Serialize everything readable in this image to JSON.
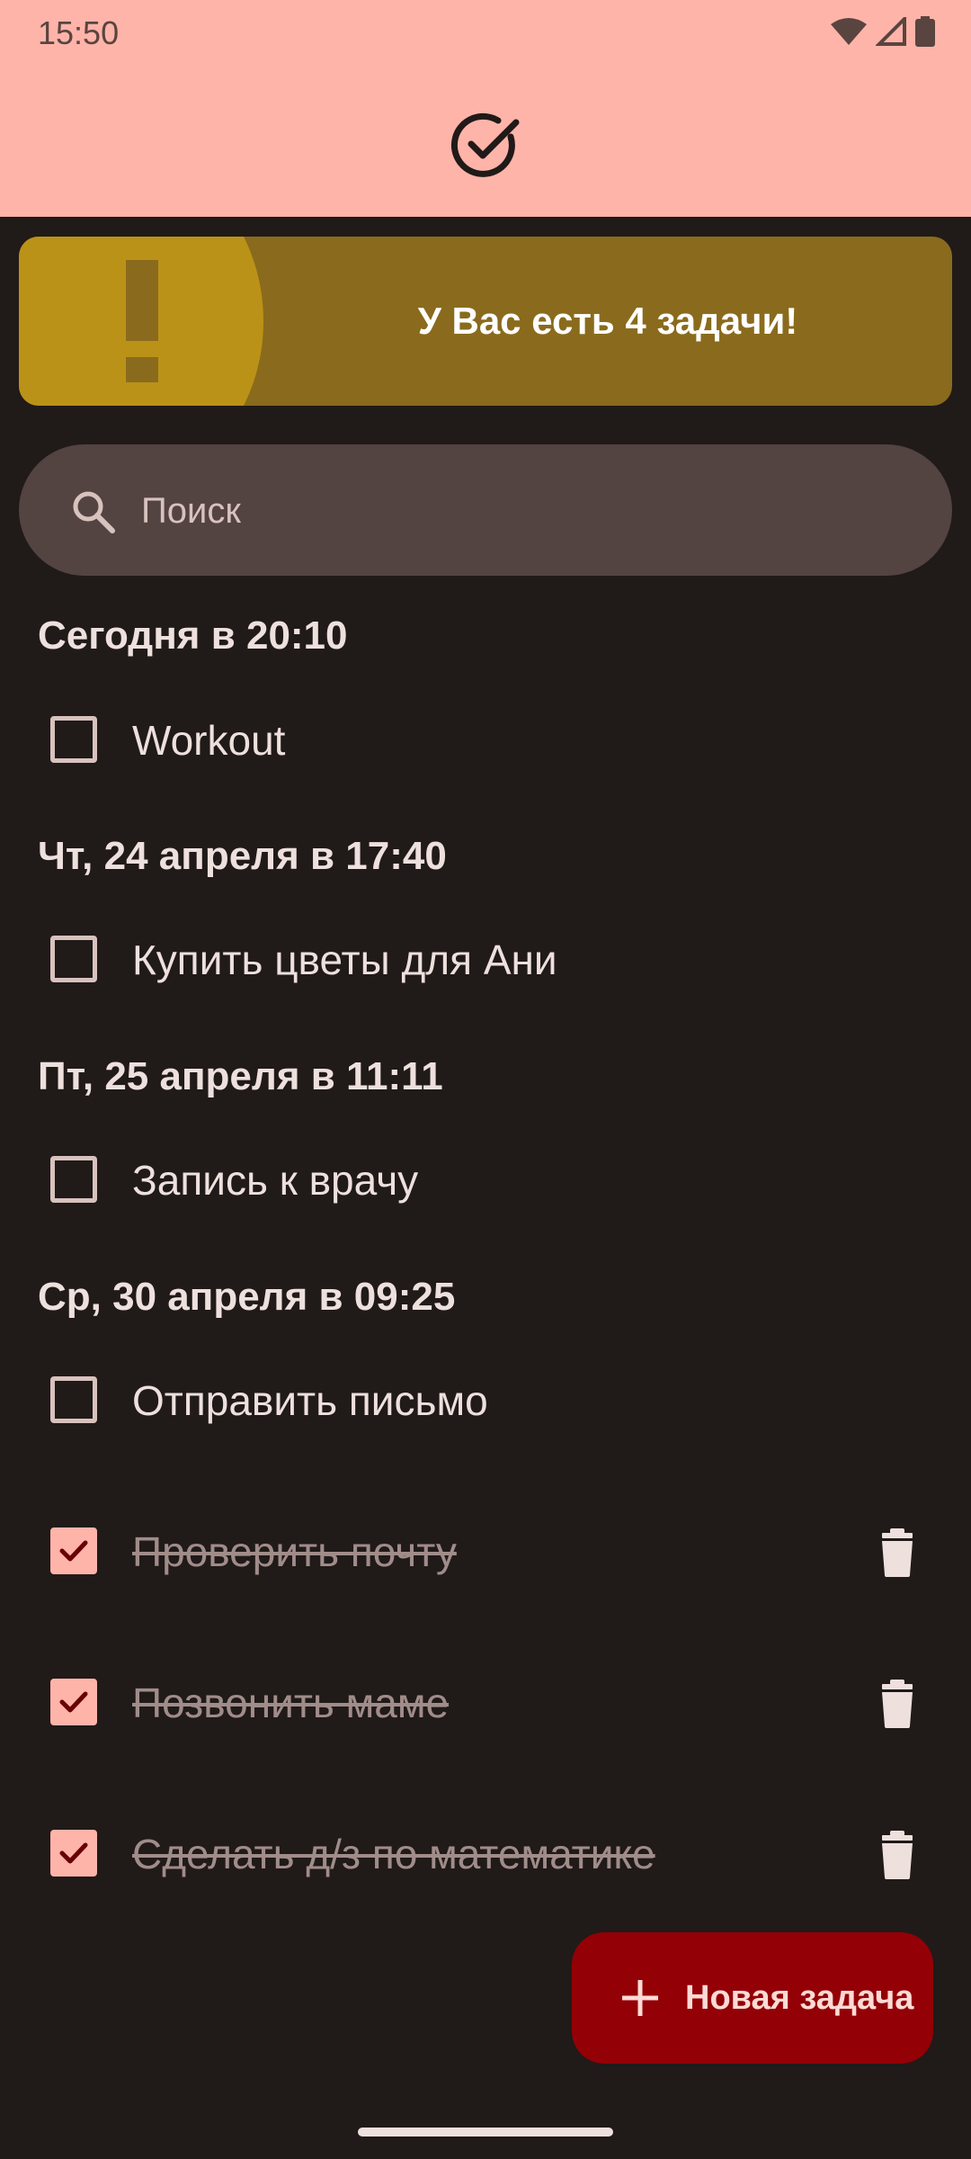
{
  "status_bar": {
    "time": "15:50",
    "icons": [
      "wifi-icon",
      "signal-icon",
      "battery-icon"
    ]
  },
  "app_bar": {
    "logo_icon": "check-circle-icon"
  },
  "banner": {
    "text": "У Вас есть 4 задачи!",
    "icon": "exclamation-icon"
  },
  "search": {
    "placeholder": "Поиск",
    "value": ""
  },
  "groups": [
    {
      "header": "Сегодня в 20:10",
      "tasks": [
        {
          "label": "Workout",
          "done": false
        }
      ]
    },
    {
      "header": "Чт, 24 апреля в 17:40",
      "tasks": [
        {
          "label": "Купить цветы для Ани",
          "done": false
        }
      ]
    },
    {
      "header": "Пт, 25 апреля в 11:11",
      "tasks": [
        {
          "label": "Запись к врачу",
          "done": false
        }
      ]
    },
    {
      "header": "Ср, 30 апреля в 09:25",
      "tasks": [
        {
          "label": "Отправить письмо",
          "done": false
        }
      ]
    }
  ],
  "completed": [
    {
      "label": "Проверить почту",
      "done": true
    },
    {
      "label": "Позвонить маме",
      "done": true
    },
    {
      "label": "Сделать д/з по математике",
      "done": true
    }
  ],
  "fab": {
    "label": "Новая задача",
    "icon": "plus-icon"
  },
  "colors": {
    "appbar": "#ffb4a9",
    "background": "#201a19",
    "banner": "#8a6b1d",
    "banner_accent": "#bb9218",
    "fab": "#930006"
  }
}
